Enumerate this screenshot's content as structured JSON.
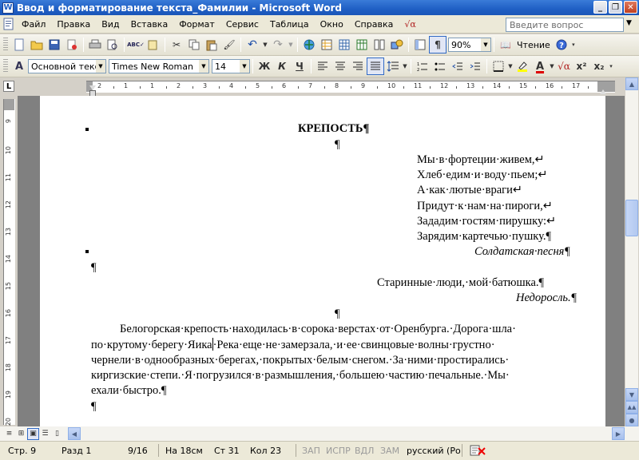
{
  "window": {
    "title": "Ввод и форматирование текста_Фамилии - Microsoft Word",
    "app_icon": "W",
    "buttons": [
      "_",
      "❐",
      "✕"
    ]
  },
  "menu": {
    "items": [
      "Файл",
      "Правка",
      "Вид",
      "Вставка",
      "Формат",
      "Сервис",
      "Таблица",
      "Окно",
      "Справка"
    ],
    "help_placeholder": "Введите вопрос"
  },
  "standard_toolbar": {
    "zoom": "90%",
    "read_label": "Чтение"
  },
  "format_toolbar": {
    "style": "Основной текст",
    "font": "Times New Roman",
    "size": "14",
    "bold": "Ж",
    "italic": "К",
    "underline": "Ч"
  },
  "hruler": {
    "numbers": [
      "2",
      "1",
      "1",
      "2",
      "3",
      "4",
      "5",
      "6",
      "7",
      "8",
      "9",
      "10",
      "11",
      "12",
      "13",
      "14",
      "15",
      "16",
      "17"
    ]
  },
  "vruler": {
    "numbers": [
      "9",
      "10",
      "11",
      "12",
      "13",
      "14",
      "15",
      "16",
      "17",
      "18",
      "19",
      "20"
    ]
  },
  "document": {
    "heading": "КРЕПОСТЬ¶",
    "empty1": "¶",
    "poem": [
      "Мы·в·фортеции·живем,↵",
      "Хлеб·едим·и·воду·пьем;↵",
      "А·как·лютые·враги↵",
      "Придут·к·нам·на·пироги,↵",
      "Зададим·гостям·пирушку:↵",
      "Зарядим·картечью·пушку.¶"
    ],
    "poem_source": "Солдатская·песня¶",
    "empty2": "¶",
    "epigraph": "Старинные·люди,·мой·батюшка.¶",
    "epigraph_source": "Недоросль.¶",
    "empty3": "¶",
    "body_lines": [
      "Белогорская·крепость·находилась·в·сорока·верстах·от·Оренбурга.·Дорога·шла·",
      "по·крутому·берегу·Яика",
      "·Река·еще·не·замерзала,·и·ее·свинцовые·волны·грустно·",
      "чернели·в·однообразных·берегах,·покрытых·белым·снегом.·За·ними·простирались·",
      "киргизские·степи.·Я·погрузился·в·размышления,·большею·частию·печальные.·Мы·",
      "ехали·быстро.¶"
    ],
    "empty4": "¶"
  },
  "statusbar": {
    "page": "Стр.  9",
    "section": "Разд  1",
    "pages": "9/16",
    "at": "На 18см",
    "line": "Ст  31",
    "col": "Кол  23",
    "rec": "ЗАП",
    "trk": "ИСПР",
    "ext": "ВДЛ",
    "ovr": "ЗАМ",
    "lang": "русский (Ро"
  }
}
